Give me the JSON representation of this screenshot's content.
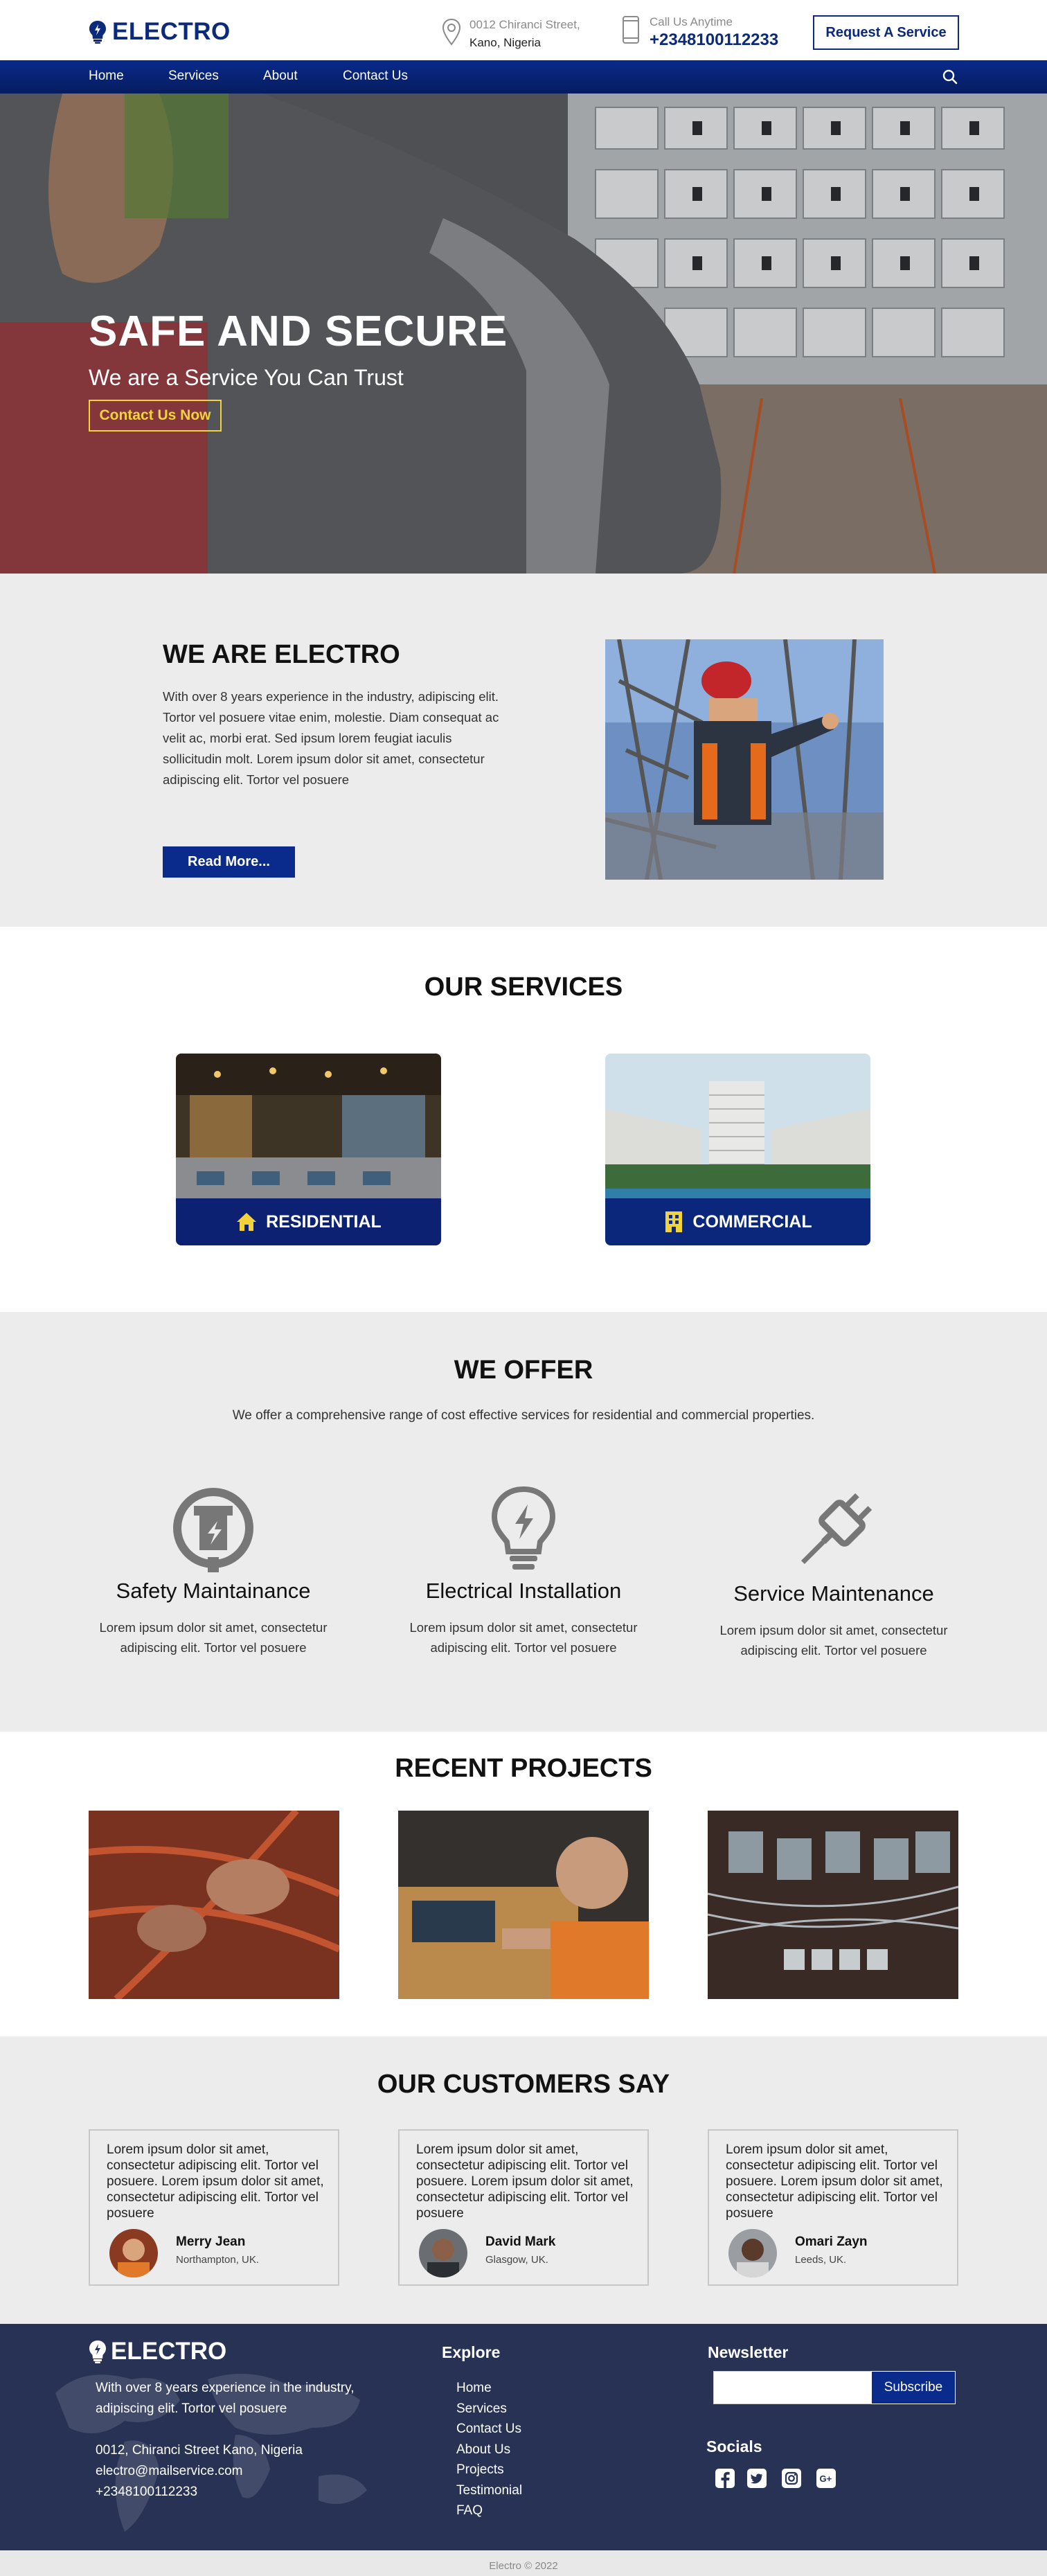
{
  "header": {
    "logo_text": "ELECTRO",
    "address_line1": "0012 Chiranci Street,",
    "address_line2": "Kano, Nigeria",
    "call_label": "Call Us Anytime",
    "call_number": "+2348100112233",
    "request_button": "Request A Service"
  },
  "nav": {
    "items": [
      "Home",
      "Services",
      "About",
      "Contact Us"
    ],
    "search_icon": "search-icon"
  },
  "hero": {
    "title": "SAFE AND SECURE",
    "subtitle": "We are a Service You Can Trust",
    "button": "Contact Us Now"
  },
  "about": {
    "title": "WE ARE ELECTRO",
    "text": "With over 8 years experience in the industry, adipiscing elit. Tortor vel posuere vitae enim, molestie. Diam consequat ac velit ac, morbi erat. Sed ipsum lorem feugiat iaculis sollicitudin molt. Lorem ipsum dolor sit amet, consectetur adipiscing elit. Tortor vel posuere",
    "button": "Read More..."
  },
  "services": {
    "title": "OUR SERVICES",
    "cards": [
      {
        "label": "RESIDENTIAL",
        "icon": "home-icon"
      },
      {
        "label": "COMMERCIAL",
        "icon": "building-icon"
      }
    ]
  },
  "offer": {
    "title": "WE OFFER",
    "lead": "We offer a comprehensive range of cost effective services for residential and commercial properties.",
    "items": [
      {
        "title": "Safety Maintainance",
        "text": "Lorem ipsum dolor sit amet, consectetur adipiscing elit. Tortor vel posuere",
        "icon": "safety-plug-icon"
      },
      {
        "title": "Electrical Installation",
        "text": "Lorem ipsum dolor sit amet, consectetur adipiscing elit. Tortor vel posuere",
        "icon": "lightbulb-icon"
      },
      {
        "title": "Service Maintenance",
        "text": "Lorem ipsum dolor sit amet, consectetur adipiscing elit. Tortor vel posuere",
        "icon": "plug-icon"
      }
    ]
  },
  "projects": {
    "title": "RECENT PROJECTS"
  },
  "testimonials": {
    "title": "OUR CUSTOMERS SAY",
    "items": [
      {
        "quote": "Lorem ipsum dolor sit amet, consectetur adipiscing elit. Tortor vel posuere. Lorem ipsum dolor sit amet, consectetur adipiscing elit. Tortor vel posuere",
        "name": "Merry Jean",
        "location": "Northampton, UK."
      },
      {
        "quote": "Lorem ipsum dolor sit amet, consectetur adipiscing elit. Tortor vel posuere. Lorem ipsum dolor sit amet, consectetur adipiscing elit. Tortor vel posuere",
        "name": "David Mark",
        "location": "Glasgow, UK."
      },
      {
        "quote": "Lorem ipsum dolor sit amet, consectetur adipiscing elit. Tortor vel posuere. Lorem ipsum dolor sit amet, consectetur adipiscing elit. Tortor vel posuere",
        "name": "Omari Zayn",
        "location": "Leeds, UK."
      }
    ]
  },
  "footer": {
    "logo_text": "ELECTRO",
    "description": "With over 8 years experience in the industry, adipiscing elit. Tortor vel posuere",
    "address": "0012, Chiranci Street Kano, Nigeria",
    "email": "electro@mailservice.com",
    "phone": "+2348100112233",
    "explore_title": "Explore",
    "links": [
      "Home",
      "Services",
      "Contact Us",
      "About Us",
      "Projects",
      "Testimonial",
      "FAQ"
    ],
    "newsletter_title": "Newsletter",
    "newsletter_placeholder": "",
    "subscribe_button": "Subscribe",
    "socials_title": "Socials",
    "socials": [
      "facebook-icon",
      "twitter-icon",
      "instagram-icon",
      "google-plus-icon"
    ]
  },
  "copyright": "Electro © 2022",
  "colors": {
    "brand_blue": "#0b2a7a",
    "nav_blue": "#0a2a8c",
    "accent_yellow": "#f2d33a",
    "footer_bg": "#273254",
    "section_gray": "#ececec"
  }
}
